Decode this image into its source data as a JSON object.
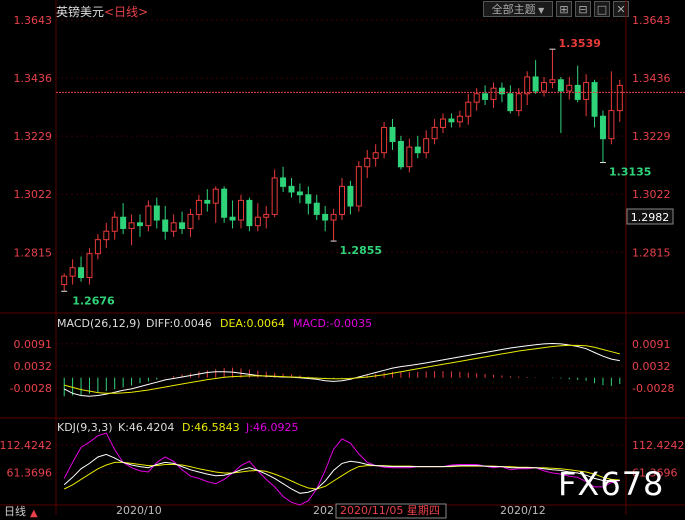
{
  "header": {
    "symbol": "英镑美元",
    "period": "<日线>",
    "theme_button": "全部主题",
    "icons": [
      "fullscreen-icon",
      "grid-icon",
      "maximize-icon",
      "close-icon"
    ]
  },
  "colors": {
    "up": "#e83a3a",
    "down": "#2fd37a",
    "grid": "#3a0000",
    "price_axis": "#e8414b",
    "dif": "#ffffff",
    "dea": "#e8e800",
    "k": "#ffffff",
    "d": "#e8e800",
    "j": "#e100e1",
    "last_line": "#e8414b"
  },
  "price_axis": {
    "ticks": [
      "1.3643",
      "1.3436",
      "1.3229",
      "1.3022",
      "1.2815"
    ],
    "last_price": "1.2982",
    "range": [
      1.262,
      1.3643
    ]
  },
  "annotations": {
    "high_label": "1.3539",
    "high_value": 1.3539,
    "low_mid_label": "1.2855",
    "low_mid_value": 1.2855,
    "low_start_label": "1.2676",
    "low_start_value": 1.2676,
    "low_right_label": "1.3135",
    "low_right_value": 1.3135
  },
  "macd": {
    "title": "MACD(26,12,9)",
    "diff_label": "DIFF:0.0046",
    "dea_label": "DEA:0.0064",
    "macd_label": "MACD:-0.0035",
    "ticks": [
      "0.0091",
      "0.0032",
      "-0.0028"
    ],
    "range": [
      -0.006,
      0.0115
    ]
  },
  "kdj": {
    "title": "KDJ(9,3,3)",
    "k_label": "K:46.4204",
    "d_label": "D:46.5843",
    "j_label": "J:46.0925",
    "ticks": [
      "112.4242",
      "61.3696"
    ],
    "range": [
      0,
      122
    ]
  },
  "x_axis": {
    "labels": [
      "2020/10",
      "202",
      "2020/11/05 星期四",
      "2020/12"
    ],
    "left_tab": "日线"
  },
  "watermark": "FX678",
  "chart_data": {
    "type": "candlestick",
    "title": "英镑美元<日线>",
    "ylim": [
      1.262,
      1.3643
    ],
    "candles": [
      {
        "o": 1.27,
        "h": 1.274,
        "l": 1.2676,
        "c": 1.273
      },
      {
        "o": 1.273,
        "h": 1.279,
        "l": 1.27,
        "c": 1.276
      },
      {
        "o": 1.276,
        "h": 1.28,
        "l": 1.271,
        "c": 1.2725
      },
      {
        "o": 1.2725,
        "h": 1.283,
        "l": 1.27,
        "c": 1.281
      },
      {
        "o": 1.281,
        "h": 1.288,
        "l": 1.279,
        "c": 1.286
      },
      {
        "o": 1.286,
        "h": 1.292,
        "l": 1.283,
        "c": 1.289
      },
      {
        "o": 1.289,
        "h": 1.296,
        "l": 1.286,
        "c": 1.294
      },
      {
        "o": 1.294,
        "h": 1.299,
        "l": 1.288,
        "c": 1.29
      },
      {
        "o": 1.29,
        "h": 1.295,
        "l": 1.284,
        "c": 1.292
      },
      {
        "o": 1.292,
        "h": 1.295,
        "l": 1.287,
        "c": 1.291
      },
      {
        "o": 1.291,
        "h": 1.3,
        "l": 1.289,
        "c": 1.298
      },
      {
        "o": 1.298,
        "h": 1.301,
        "l": 1.29,
        "c": 1.293
      },
      {
        "o": 1.293,
        "h": 1.298,
        "l": 1.286,
        "c": 1.289
      },
      {
        "o": 1.289,
        "h": 1.295,
        "l": 1.287,
        "c": 1.292
      },
      {
        "o": 1.292,
        "h": 1.296,
        "l": 1.288,
        "c": 1.29
      },
      {
        "o": 1.29,
        "h": 1.297,
        "l": 1.287,
        "c": 1.295
      },
      {
        "o": 1.295,
        "h": 1.302,
        "l": 1.293,
        "c": 1.3
      },
      {
        "o": 1.3,
        "h": 1.304,
        "l": 1.296,
        "c": 1.299
      },
      {
        "o": 1.299,
        "h": 1.305,
        "l": 1.292,
        "c": 1.304
      },
      {
        "o": 1.304,
        "h": 1.305,
        "l": 1.292,
        "c": 1.294
      },
      {
        "o": 1.294,
        "h": 1.3,
        "l": 1.29,
        "c": 1.293
      },
      {
        "o": 1.293,
        "h": 1.302,
        "l": 1.29,
        "c": 1.3
      },
      {
        "o": 1.3,
        "h": 1.301,
        "l": 1.289,
        "c": 1.291
      },
      {
        "o": 1.291,
        "h": 1.299,
        "l": 1.289,
        "c": 1.294
      },
      {
        "o": 1.294,
        "h": 1.298,
        "l": 1.29,
        "c": 1.295
      },
      {
        "o": 1.295,
        "h": 1.311,
        "l": 1.294,
        "c": 1.308
      },
      {
        "o": 1.308,
        "h": 1.312,
        "l": 1.303,
        "c": 1.305
      },
      {
        "o": 1.305,
        "h": 1.308,
        "l": 1.301,
        "c": 1.303
      },
      {
        "o": 1.303,
        "h": 1.306,
        "l": 1.299,
        "c": 1.302
      },
      {
        "o": 1.302,
        "h": 1.305,
        "l": 1.295,
        "c": 1.299
      },
      {
        "o": 1.299,
        "h": 1.302,
        "l": 1.293,
        "c": 1.295
      },
      {
        "o": 1.295,
        "h": 1.298,
        "l": 1.289,
        "c": 1.293
      },
      {
        "o": 1.293,
        "h": 1.297,
        "l": 1.2855,
        "c": 1.295
      },
      {
        "o": 1.295,
        "h": 1.308,
        "l": 1.293,
        "c": 1.305
      },
      {
        "o": 1.305,
        "h": 1.307,
        "l": 1.295,
        "c": 1.298
      },
      {
        "o": 1.298,
        "h": 1.314,
        "l": 1.296,
        "c": 1.312
      },
      {
        "o": 1.312,
        "h": 1.318,
        "l": 1.308,
        "c": 1.315
      },
      {
        "o": 1.315,
        "h": 1.32,
        "l": 1.312,
        "c": 1.317
      },
      {
        "o": 1.317,
        "h": 1.328,
        "l": 1.315,
        "c": 1.326
      },
      {
        "o": 1.326,
        "h": 1.329,
        "l": 1.318,
        "c": 1.321
      },
      {
        "o": 1.321,
        "h": 1.323,
        "l": 1.311,
        "c": 1.312
      },
      {
        "o": 1.312,
        "h": 1.322,
        "l": 1.31,
        "c": 1.319
      },
      {
        "o": 1.319,
        "h": 1.323,
        "l": 1.315,
        "c": 1.317
      },
      {
        "o": 1.317,
        "h": 1.325,
        "l": 1.315,
        "c": 1.322
      },
      {
        "o": 1.322,
        "h": 1.329,
        "l": 1.32,
        "c": 1.326
      },
      {
        "o": 1.326,
        "h": 1.331,
        "l": 1.324,
        "c": 1.329
      },
      {
        "o": 1.329,
        "h": 1.331,
        "l": 1.326,
        "c": 1.328
      },
      {
        "o": 1.328,
        "h": 1.332,
        "l": 1.326,
        "c": 1.33
      },
      {
        "o": 1.33,
        "h": 1.338,
        "l": 1.327,
        "c": 1.335
      },
      {
        "o": 1.335,
        "h": 1.34,
        "l": 1.332,
        "c": 1.338
      },
      {
        "o": 1.338,
        "h": 1.341,
        "l": 1.334,
        "c": 1.336
      },
      {
        "o": 1.336,
        "h": 1.342,
        "l": 1.333,
        "c": 1.34
      },
      {
        "o": 1.34,
        "h": 1.342,
        "l": 1.335,
        "c": 1.338
      },
      {
        "o": 1.338,
        "h": 1.341,
        "l": 1.331,
        "c": 1.332
      },
      {
        "o": 1.332,
        "h": 1.34,
        "l": 1.33,
        "c": 1.338
      },
      {
        "o": 1.338,
        "h": 1.346,
        "l": 1.334,
        "c": 1.344
      },
      {
        "o": 1.344,
        "h": 1.35,
        "l": 1.338,
        "c": 1.339
      },
      {
        "o": 1.339,
        "h": 1.344,
        "l": 1.337,
        "c": 1.342
      },
      {
        "o": 1.342,
        "h": 1.3539,
        "l": 1.34,
        "c": 1.343
      },
      {
        "o": 1.343,
        "h": 1.344,
        "l": 1.324,
        "c": 1.339
      },
      {
        "o": 1.339,
        "h": 1.344,
        "l": 1.336,
        "c": 1.341
      },
      {
        "o": 1.341,
        "h": 1.348,
        "l": 1.335,
        "c": 1.336
      },
      {
        "o": 1.336,
        "h": 1.345,
        "l": 1.33,
        "c": 1.342
      },
      {
        "o": 1.342,
        "h": 1.343,
        "l": 1.326,
        "c": 1.33
      },
      {
        "o": 1.33,
        "h": 1.332,
        "l": 1.3135,
        "c": 1.322
      },
      {
        "o": 1.322,
        "h": 1.346,
        "l": 1.32,
        "c": 1.332
      },
      {
        "o": 1.332,
        "h": 1.343,
        "l": 1.328,
        "c": 1.341
      }
    ],
    "macd_hist": [
      -0.005,
      -0.0048,
      -0.0046,
      -0.0043,
      -0.004,
      -0.0036,
      -0.0031,
      -0.0026,
      -0.0021,
      -0.0015,
      -0.001,
      -0.0005,
      0.0001,
      0.0005,
      0.0009,
      0.0012,
      0.0017,
      0.002,
      0.0023,
      0.0026,
      0.0027,
      0.0025,
      0.0022,
      0.0019,
      0.0016,
      0.0013,
      0.0011,
      0.0009,
      0.0006,
      0.0003,
      0.0001,
      -0.0002,
      -0.0003,
      -0.0002,
      0.0001,
      0.0004,
      0.0007,
      0.001,
      0.0014,
      0.0016,
      0.0016,
      0.0015,
      0.0016,
      0.0017,
      0.0018,
      0.0018,
      0.0017,
      0.0016,
      0.0014,
      0.0012,
      0.001,
      0.0008,
      0.0006,
      0.0004,
      0.0003,
      0.0002,
      0.0001,
      0.0,
      -0.0001,
      -0.0002,
      -0.0004,
      -0.0006,
      -0.0008,
      -0.0015,
      -0.002,
      -0.0022,
      -0.0017
    ],
    "macd_diff": [
      -0.003,
      -0.0042,
      -0.0048,
      -0.005,
      -0.0048,
      -0.0044,
      -0.0039,
      -0.0034,
      -0.003,
      -0.0024,
      -0.0018,
      -0.0012,
      -0.0006,
      -0.0002,
      0.0002,
      0.0006,
      0.001,
      0.0014,
      0.0016,
      0.0016,
      0.0015,
      0.0012,
      0.0009,
      0.0006,
      0.0004,
      0.0003,
      0.0002,
      0.0001,
      0.0,
      -0.0002,
      -0.0004,
      -0.0008,
      -0.001,
      -0.0008,
      -0.0004,
      0.0002,
      0.0008,
      0.0014,
      0.002,
      0.0026,
      0.003,
      0.0033,
      0.0036,
      0.004,
      0.0044,
      0.0048,
      0.0052,
      0.0056,
      0.006,
      0.0064,
      0.0068,
      0.0072,
      0.0076,
      0.008,
      0.0083,
      0.0086,
      0.0089,
      0.0091,
      0.0092,
      0.0091,
      0.0088,
      0.0084,
      0.0078,
      0.0068,
      0.0058,
      0.005,
      0.0046
    ],
    "macd_dea": [
      -0.002,
      -0.0026,
      -0.0032,
      -0.0036,
      -0.004,
      -0.0042,
      -0.0042,
      -0.0041,
      -0.0039,
      -0.0036,
      -0.0033,
      -0.0029,
      -0.0025,
      -0.0021,
      -0.0017,
      -0.0013,
      -0.0009,
      -0.0005,
      -0.0002,
      0.0001,
      0.0003,
      0.0004,
      0.0005,
      0.0005,
      0.0005,
      0.0004,
      0.0003,
      0.0002,
      0.0001,
      0.0,
      -0.0001,
      -0.0002,
      -0.0003,
      -0.0003,
      -0.0002,
      0.0,
      0.0002,
      0.0005,
      0.0008,
      0.0012,
      0.0016,
      0.002,
      0.0024,
      0.0028,
      0.0032,
      0.0036,
      0.004,
      0.0044,
      0.0048,
      0.0052,
      0.0056,
      0.006,
      0.0064,
      0.0068,
      0.0072,
      0.0075,
      0.0078,
      0.0081,
      0.0084,
      0.0086,
      0.0087,
      0.0087,
      0.0086,
      0.0082,
      0.0076,
      0.007,
      0.0064
    ],
    "kdj_k": [
      38,
      52,
      68,
      78,
      90,
      95,
      88,
      80,
      75,
      72,
      70,
      76,
      80,
      78,
      72,
      66,
      62,
      58,
      55,
      56,
      60,
      66,
      70,
      65,
      58,
      50,
      40,
      30,
      22,
      24,
      30,
      45,
      65,
      78,
      82,
      80,
      76,
      74,
      73,
      72,
      72,
      72,
      72,
      72,
      72,
      72,
      73,
      74,
      74,
      74,
      73,
      72,
      72,
      70,
      70,
      70,
      70,
      68,
      66,
      65,
      62,
      60,
      56,
      50,
      46,
      46,
      46
    ],
    "kdj_d": [
      30,
      38,
      48,
      58,
      68,
      75,
      80,
      80,
      78,
      76,
      74,
      74,
      76,
      76,
      75,
      72,
      68,
      65,
      62,
      60,
      60,
      62,
      64,
      65,
      63,
      58,
      52,
      45,
      38,
      32,
      30,
      35,
      45,
      55,
      65,
      72,
      74,
      74,
      74,
      73,
      73,
      73,
      72,
      72,
      72,
      72,
      72,
      73,
      73,
      73,
      73,
      73,
      72,
      72,
      71,
      71,
      70,
      70,
      69,
      68,
      66,
      64,
      62,
      58,
      52,
      48,
      47
    ],
    "kdj_j": [
      50,
      80,
      108,
      118,
      130,
      135,
      104,
      80,
      70,
      64,
      62,
      80,
      90,
      82,
      66,
      54,
      50,
      44,
      40,
      48,
      60,
      74,
      82,
      64,
      48,
      34,
      16,
      5,
      0,
      8,
      30,
      65,
      105,
      124,
      116,
      96,
      80,
      74,
      71,
      70,
      70,
      70,
      72,
      72,
      72,
      72,
      75,
      76,
      76,
      76,
      73,
      70,
      72,
      66,
      68,
      68,
      70,
      64,
      60,
      58,
      54,
      52,
      44,
      34,
      34,
      42,
      46
    ]
  }
}
